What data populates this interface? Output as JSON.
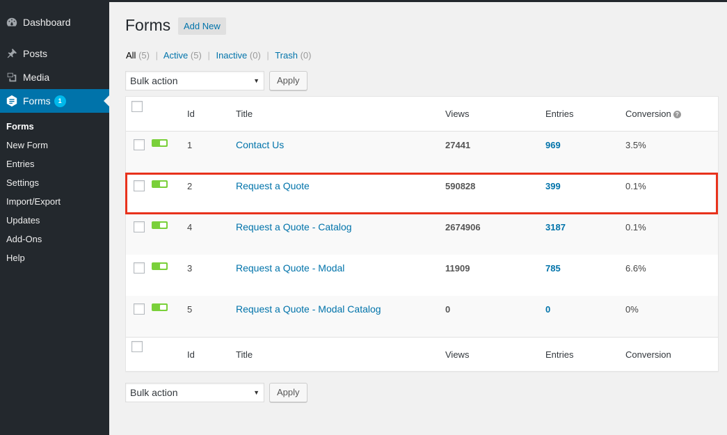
{
  "sidebar": {
    "items": [
      {
        "label": "Dashboard",
        "icon": "dashboard-icon"
      },
      {
        "label": "Posts",
        "icon": "pin-icon"
      },
      {
        "label": "Media",
        "icon": "media-icon"
      },
      {
        "label": "Forms",
        "icon": "forms-icon",
        "badge": "1"
      }
    ],
    "submenu": [
      "Forms",
      "New Form",
      "Entries",
      "Settings",
      "Import/Export",
      "Updates",
      "Add-Ons",
      "Help"
    ]
  },
  "page": {
    "title": "Forms",
    "add_new": "Add New"
  },
  "filters": [
    {
      "label": "All",
      "count": "(5)"
    },
    {
      "label": "Active",
      "count": "(5)"
    },
    {
      "label": "Inactive",
      "count": "(0)"
    },
    {
      "label": "Trash",
      "count": "(0)"
    }
  ],
  "bulk": {
    "select_value": "Bulk action",
    "apply_label": "Apply"
  },
  "table": {
    "headers": {
      "id": "Id",
      "title": "Title",
      "views": "Views",
      "entries": "Entries",
      "conversion": "Conversion"
    },
    "rows": [
      {
        "id": "1",
        "title": "Contact Us",
        "views": "27441",
        "entries": "969",
        "conversion": "3.5%"
      },
      {
        "id": "2",
        "title": "Request a Quote",
        "views": "590828",
        "entries": "399",
        "conversion": "0.1%"
      },
      {
        "id": "4",
        "title": "Request a Quote - Catalog",
        "views": "2674906",
        "entries": "3187",
        "conversion": "0.1%"
      },
      {
        "id": "3",
        "title": "Request a Quote - Modal",
        "views": "11909",
        "entries": "785",
        "conversion": "6.6%"
      },
      {
        "id": "5",
        "title": "Request a Quote - Modal Catalog",
        "views": "0",
        "entries": "0",
        "conversion": "0%"
      }
    ]
  },
  "colors": {
    "sidebar_bg": "#23282d",
    "accent": "#0073aa",
    "active_toggle": "#7ad03a",
    "highlight": "#e8321c"
  }
}
